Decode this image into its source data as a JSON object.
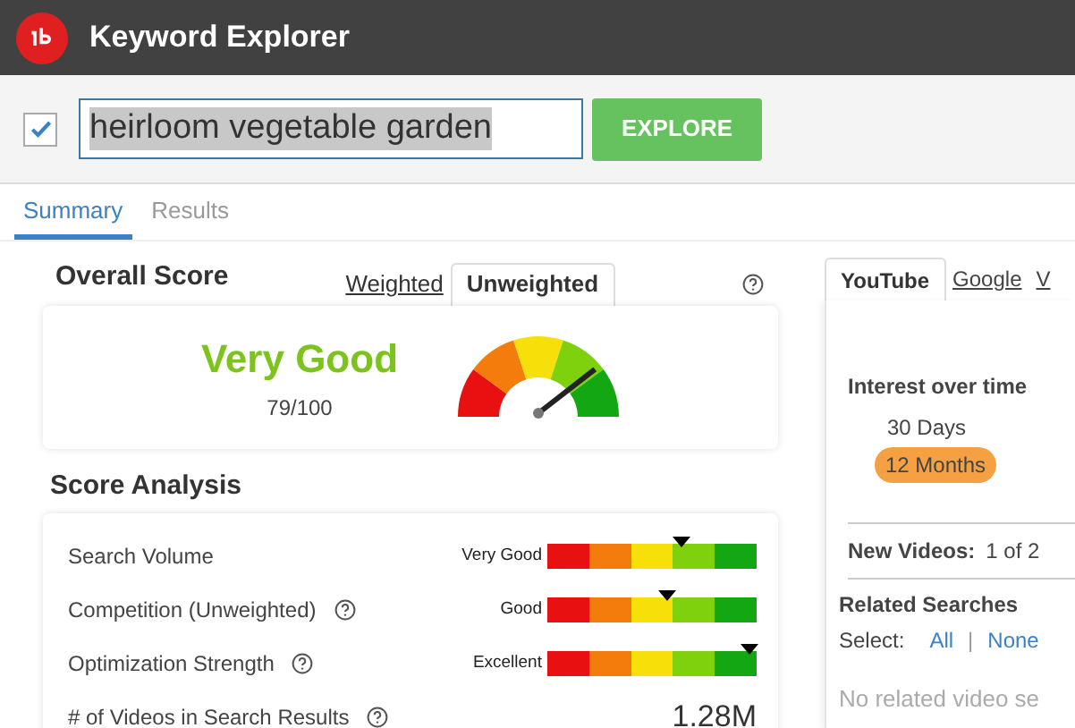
{
  "app": {
    "title": "Keyword Explorer"
  },
  "search": {
    "checked": true,
    "value": "heirloom vegetable garden",
    "button": "EXPLORE"
  },
  "tabs": [
    {
      "label": "Summary",
      "selected": true
    },
    {
      "label": "Results",
      "selected": false
    }
  ],
  "overall": {
    "title": "Overall Score",
    "modes": [
      {
        "label": "Weighted",
        "selected": false
      },
      {
        "label": "Unweighted",
        "selected": true
      }
    ],
    "rating": "Very Good",
    "score": "79/100",
    "level": 0.79
  },
  "analysis": {
    "title": "Score Analysis",
    "rows": [
      {
        "kind": "bar",
        "label": "Search Volume",
        "help": false,
        "rating": "Very Good",
        "level": 0.64
      },
      {
        "kind": "bar",
        "label": "Competition (Unweighted)",
        "help": true,
        "rating": "Good",
        "level": 0.57
      },
      {
        "kind": "bar",
        "label": "Optimization Strength",
        "help": true,
        "rating": "Excellent",
        "level": 0.97
      },
      {
        "kind": "value",
        "label": "# of Videos in Search Results",
        "help": true,
        "value": "1.28M"
      }
    ]
  },
  "side": {
    "tabs": [
      {
        "label": "YouTube",
        "selected": true
      },
      {
        "label": "Google",
        "selected": false
      },
      {
        "label": "V",
        "selected": false
      }
    ],
    "interest_title": "Interest over time",
    "ranges": [
      {
        "label": "30 Days",
        "selected": false
      },
      {
        "label": "12 Months",
        "selected": true
      }
    ],
    "new_videos_label": "New Videos:",
    "new_videos_value": "1 of 2",
    "related_title": "Related Searches",
    "select_label": "Select:",
    "select_all": "All",
    "separator": "|",
    "select_none": "None",
    "empty": "No related video se"
  }
}
